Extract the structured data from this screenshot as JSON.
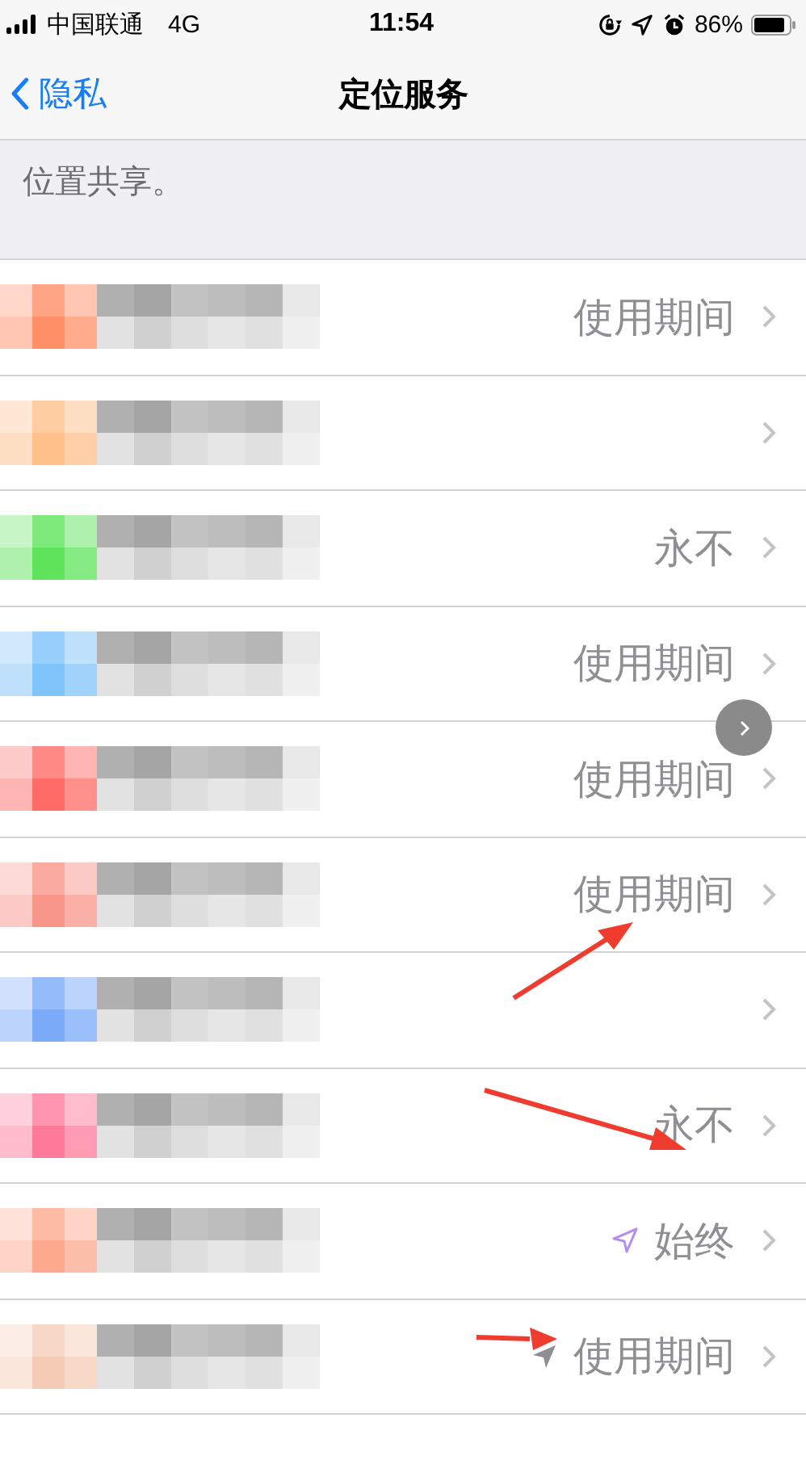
{
  "status_bar": {
    "carrier": "中国联通",
    "network": "4G",
    "time": "11:54",
    "battery": "86%"
  },
  "nav": {
    "back": "隐私",
    "title": "定位服务"
  },
  "group_footer": "位置共享。",
  "apps": [
    {
      "color": "#ff8f66",
      "value": "使用期间"
    },
    {
      "color": "#ffc08a"
    },
    {
      "color": "#5ee35a",
      "value": "永不"
    },
    {
      "color": "#7fc4fa",
      "value": "使用期间"
    },
    {
      "color": "#ff6b66",
      "value": "使用期间"
    },
    {
      "color": "#f8968a",
      "value": "使用期间"
    },
    {
      "color": "#7aaaf8"
    },
    {
      "color": "#ff7a9a",
      "value": "永不"
    },
    {
      "color": "#fca98e",
      "value": "始终",
      "location_icon": {
        "color": "#b48cf5",
        "filled": false
      }
    },
    {
      "color": "#f5cdb6",
      "value": "使用期间",
      "location_icon": {
        "color": "#8e8e93",
        "filled": true
      }
    }
  ]
}
